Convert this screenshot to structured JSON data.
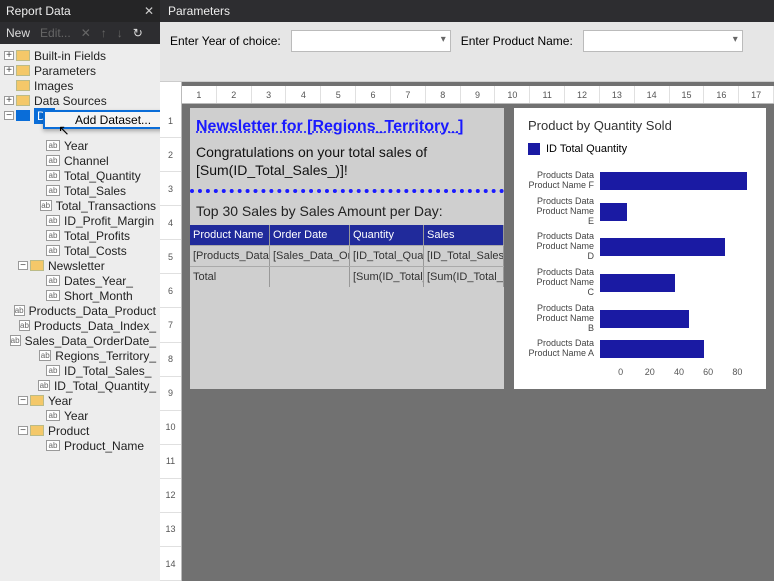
{
  "left_panel": {
    "title": "Report Data",
    "toolbar": {
      "new": "New",
      "edit": "Edit..."
    },
    "context_menu_label": "Add Dataset...",
    "folders_top": [
      {
        "label": "Built-in Fields"
      },
      {
        "label": "Parameters"
      },
      {
        "label": "Images"
      },
      {
        "label": "Data Sources"
      }
    ],
    "datasets_label": "Da",
    "newsletter_label": "Newsletter",
    "ds_fields": [
      "Year",
      "Channel",
      "Total_Quantity",
      "Total_Sales",
      "Total_Transactions",
      "ID_Profit_Margin",
      "Total_Profits",
      "Total_Costs"
    ],
    "newsletter_fields": [
      "Dates_Year_",
      "Short_Month",
      "Products_Data_Product",
      "Products_Data_Index_",
      "Sales_Data_OrderDate_",
      "Regions_Territory_",
      "ID_Total_Sales_",
      "ID_Total_Quantity_"
    ],
    "year_node": {
      "label": "Year",
      "fields": [
        "Year"
      ]
    },
    "product_node": {
      "label": "Product",
      "fields": [
        "Product_Name"
      ]
    }
  },
  "parameters": {
    "header": "Parameters",
    "p1_label": "Enter Year of choice:",
    "p2_label": "Enter Product Name:"
  },
  "hruler": [
    "1",
    "2",
    "3",
    "4",
    "5",
    "6",
    "7",
    "8",
    "9",
    "10",
    "11",
    "12",
    "13",
    "14",
    "15",
    "16",
    "17"
  ],
  "vruler": [
    "1",
    "2",
    "3",
    "4",
    "5",
    "6",
    "7",
    "8",
    "9",
    "10",
    "11",
    "12",
    "13",
    "14"
  ],
  "report": {
    "title": "Newsletter for [Regions_Territory_]",
    "congrats_l1": "Congratulations on your total sales of",
    "congrats_l2": "[Sum(ID_Total_Sales_)]!",
    "top30": "Top 30 Sales by Sales Amount per Day:",
    "headers": [
      "Product Name",
      "Order Date",
      "Quantity",
      "Sales"
    ],
    "row1": [
      "[Products_Data",
      "[Sales_Data_Or",
      "[ID_Total_Quant",
      "[ID_Total_Sales"
    ],
    "row2": [
      "Total",
      "",
      "[Sum(ID_Total_Q",
      "[Sum(ID_Total_"
    ]
  },
  "chart_data": {
    "type": "bar",
    "title": "Product by Quantity Sold",
    "legend": "ID Total Quantity",
    "xlabel": "",
    "ylabel": "",
    "xlim": [
      0,
      85
    ],
    "axis_ticks": [
      "0",
      "20",
      "40",
      "60",
      "80"
    ],
    "categories": [
      "Products Data Product Name F",
      "Products Data Product Name E",
      "Products Data Product Name D",
      "Products Data Product Name C",
      "Products Data Product Name B",
      "Products Data Product Name A"
    ],
    "values": [
      82,
      15,
      70,
      42,
      50,
      58
    ]
  }
}
